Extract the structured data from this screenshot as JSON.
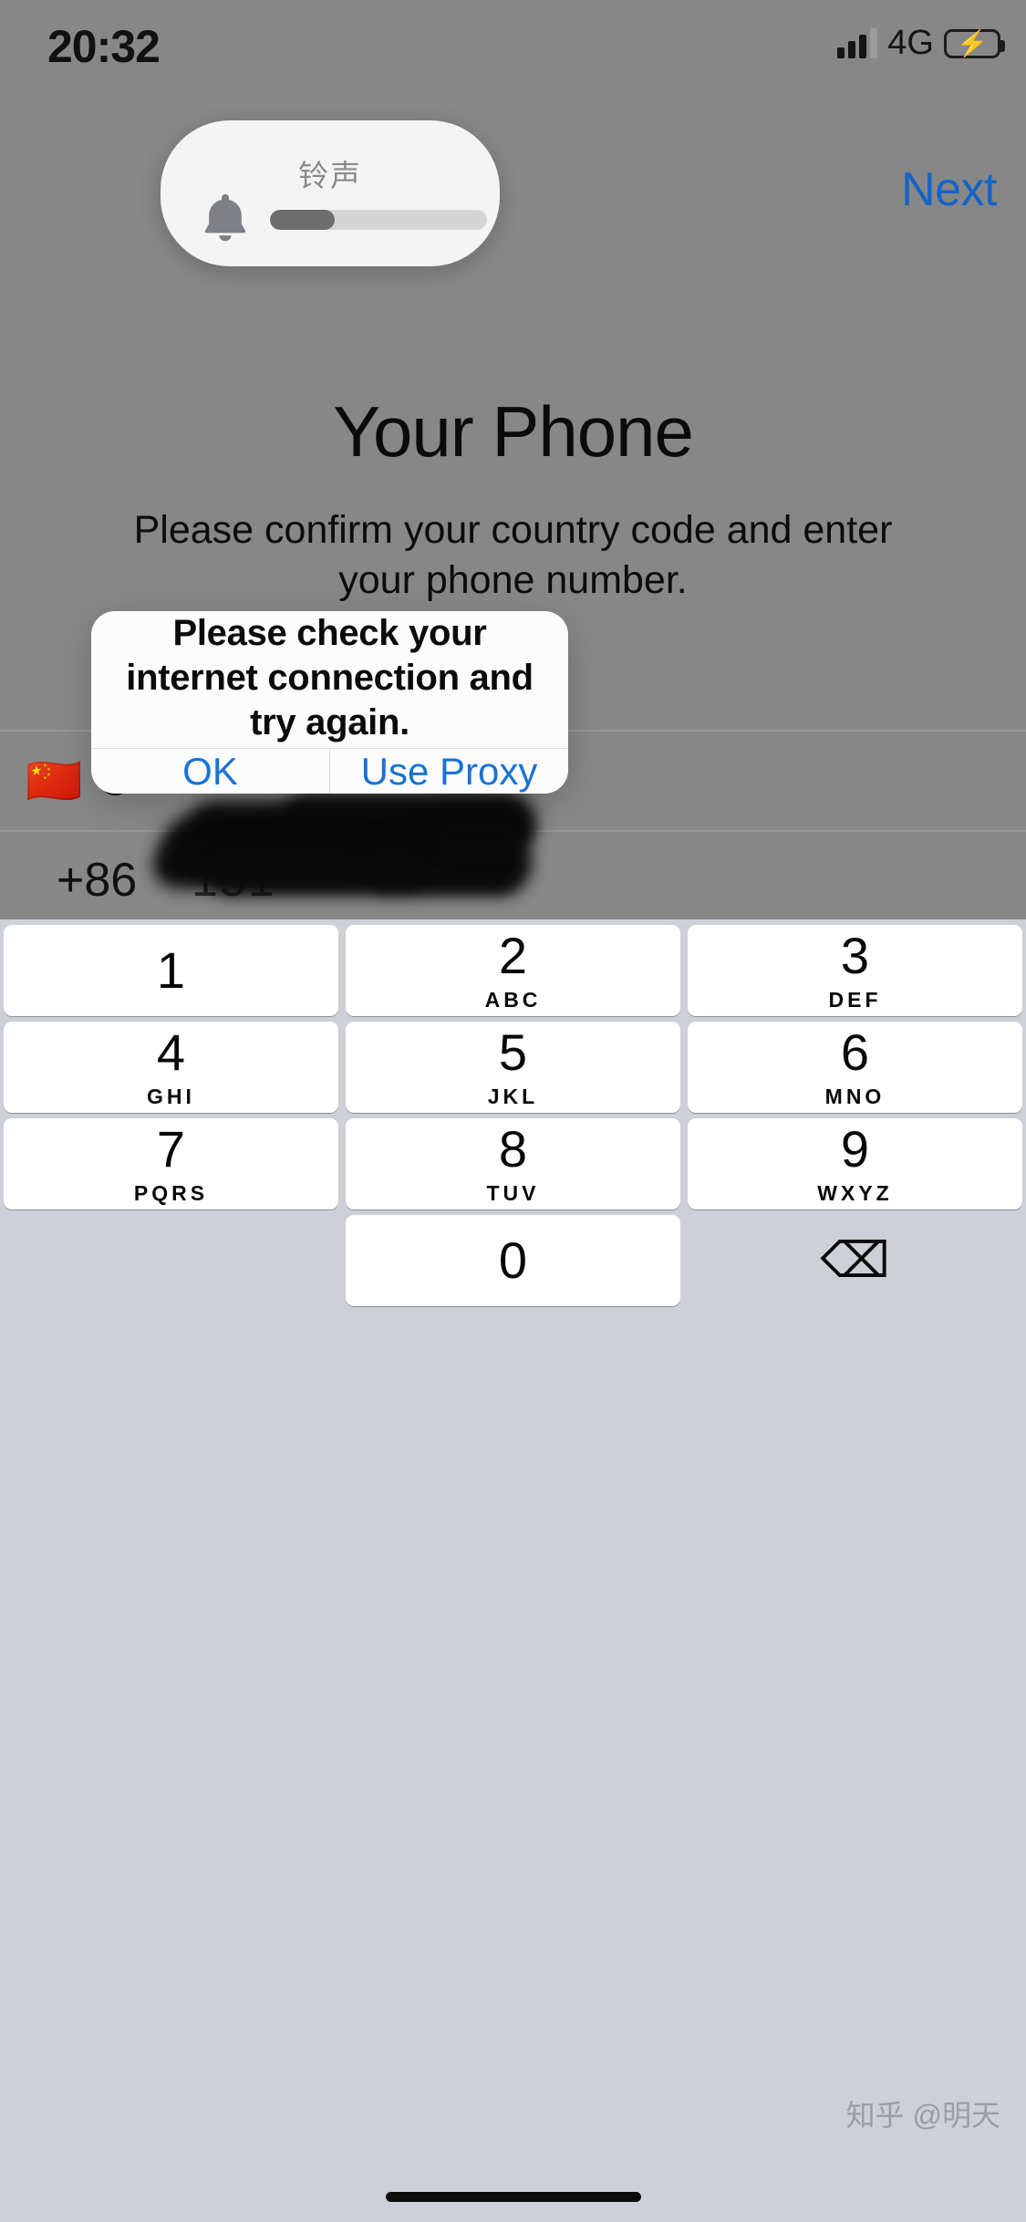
{
  "status_bar": {
    "time": "20:32",
    "network": "4G",
    "signal_icon": "signal-bars-icon",
    "battery_icon": "battery-charging-icon",
    "bolt_glyph": "⚡"
  },
  "volume_hud": {
    "label": "铃声",
    "bell_icon": "bell-icon",
    "volume_percent": 30
  },
  "nav": {
    "next_label": "Next"
  },
  "page": {
    "title": "Your Phone",
    "subtitle": "Please confirm your country code and enter your phone number."
  },
  "form": {
    "country": {
      "flag": "🇨🇳",
      "name": "C"
    },
    "phone": {
      "dial_code": "+86",
      "number": "151",
      "redacted": true
    }
  },
  "alert": {
    "message": "Please check your internet connection and try again.",
    "buttons": [
      {
        "label": "OK"
      },
      {
        "label": "Use Proxy"
      }
    ]
  },
  "keypad": {
    "rows": [
      [
        {
          "num": "1",
          "letters": ""
        },
        {
          "num": "2",
          "letters": "ABC"
        },
        {
          "num": "3",
          "letters": "DEF"
        }
      ],
      [
        {
          "num": "4",
          "letters": "GHI"
        },
        {
          "num": "5",
          "letters": "JKL"
        },
        {
          "num": "6",
          "letters": "MNO"
        }
      ],
      [
        {
          "num": "7",
          "letters": "PQRS"
        },
        {
          "num": "8",
          "letters": "TUV"
        },
        {
          "num": "9",
          "letters": "WXYZ"
        }
      ]
    ],
    "zero": {
      "num": "0",
      "letters": ""
    },
    "delete_icon": "backspace-icon",
    "delete_glyph": "⌫"
  },
  "watermark": {
    "text": "知乎 @明天"
  },
  "colors": {
    "accent_blue": "#1a72d4",
    "next_blue": "#1463c6",
    "dim_overlay": "#878787",
    "keypad_bg": "#cdd0d6",
    "battery_green": "#4cd447"
  }
}
